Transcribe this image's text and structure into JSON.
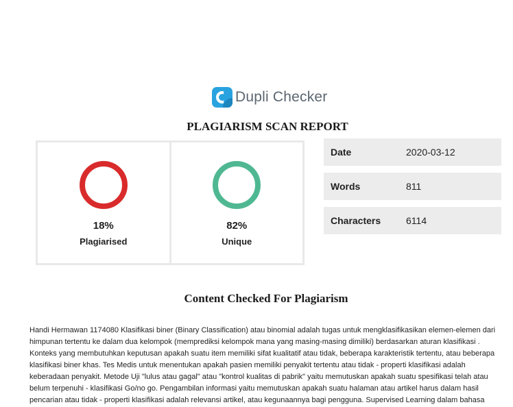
{
  "brand": {
    "name": "Dupli Checker",
    "icon": "dupli-checker-logo-icon",
    "color": "#29a3df"
  },
  "report": {
    "title": "PLAGIARISM SCAN REPORT"
  },
  "scores": {
    "plagiarised": {
      "percent": "18%",
      "label": "Plagiarised",
      "value": 18,
      "color": "#d92b2b"
    },
    "unique": {
      "percent": "82%",
      "label": "Unique",
      "value": 82,
      "color": "#4fb892"
    }
  },
  "info": {
    "date": {
      "label": "Date",
      "value": "2020-03-12"
    },
    "words": {
      "label": "Words",
      "value": "811"
    },
    "characters": {
      "label": "Characters",
      "value": "6114"
    }
  },
  "content": {
    "title": "Content Checked For Plagiarism",
    "lines": [
      "Handi Hermawan 1174080 Klasifikasi biner (Binary Classification) atau binomial adalah tugas untuk mengklasifikasikan elemen-elemen dari",
      "himpunan tertentu ke dalam dua kelompok (memprediksi kelompok mana yang masing-masing dimiliki) berdasarkan aturan klasifikasi .",
      "Konteks yang membutuhkan keputusan apakah suatu item memiliki sifat kualitatif atau tidak, beberapa karakteristik tertentu, atau beberapa",
      "klasifikasi biner khas. Tes Medis untuk menentukan apakah pasien memiliki penyakit tertentu atau tidak - properti klasifikasi adalah",
      "keberadaan penyakit. Metode Uji \"lulus atau gagal\" atau \"kontrol kualitas di pabrik\" yaitu memutuskan apakah suatu spesifikasi telah atau",
      "belum terpenuhi - klasifikasi Go/no go. Pengambilan informasi yaitu memutuskan apakah suatu halaman atau artikel harus dalam hasil",
      "pencarian atau tidak - properti klasifikasi adalah relevansi artikel, atau kegunaannya bagi pengguna. Supervised Learning dalam bahasa"
    ]
  }
}
